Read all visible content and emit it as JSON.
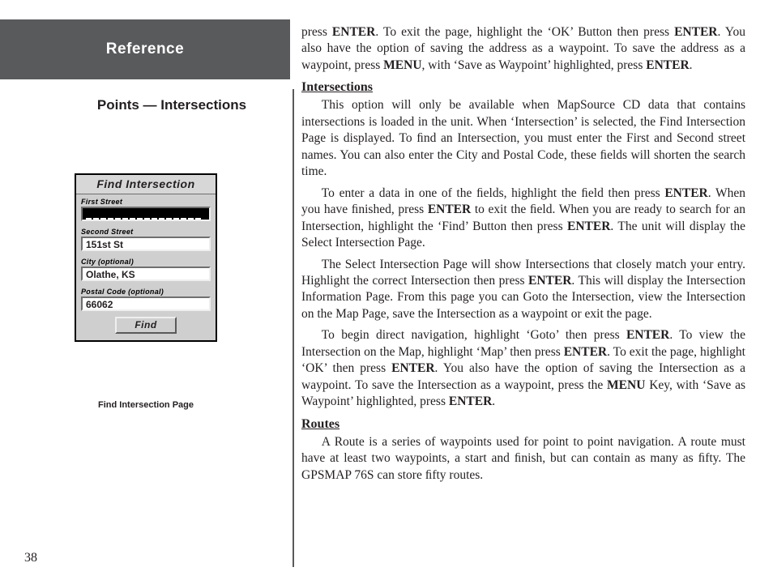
{
  "page_number": "38",
  "banner": {
    "title": "Reference"
  },
  "section_title": "Points — Intersections",
  "device": {
    "header": "Find Intersection",
    "labels": {
      "first_street": "First Street",
      "second_street": "Second Street",
      "city": "City (optional)",
      "postal": "Postal Code (optional)"
    },
    "values": {
      "first_street": "",
      "second_street": "151st St",
      "city": "Olathe, KS",
      "postal": "66062"
    },
    "find_btn": "Find",
    "caption": "Find Intersection Page"
  },
  "body": {
    "p1_a": "press ",
    "k_enter": "ENTER",
    "p1_b": ".  To exit the page, highlight the ‘OK’ Button then press ",
    "p1_c": ". You also have the option of saving the address as a waypoint.  To save the address as a waypoint, press ",
    "k_menu": "MENU",
    "p1_d": ", with ‘Save as Waypoint’ highlighted, press ",
    "p1_e": ".",
    "h_intersections": "Intersections",
    "p2": "This option will only be available when MapSource CD data that contains intersections is loaded in the unit.  When ‘Intersection’ is selected, the Find Intersection Page is displayed.  To ﬁnd an Intersection, you must enter the First and Second street names.  You can also enter the City and Postal Code, these ﬁelds will shorten the search time.",
    "p3_a": "To enter a data in one of the ﬁelds, highlight the ﬁeld then press ",
    "p3_b": ".  When you have ﬁnished, press ",
    "p3_c": " to exit the ﬁeld.  When you are ready to search for an Intersection, highlight the ‘Find’ Button then press ",
    "p3_d": ".  The unit will display the Select Intersection Page.",
    "p4_a": "The Select Intersection Page will show Intersections that closely match your entry.  Highlight the correct Intersection then press ",
    "p4_b": ".  This will display the Intersection Information Page.  From this page you can Goto the Intersection, view the Intersection on the Map Page, save the Intersection as a waypoint or exit the page.",
    "p5_a": "To begin direct navigation, highlight ‘Goto’ then press ",
    "p5_b": ".  To view the Intersection on the Map, highlight ‘Map’ then press ",
    "p5_c": ".  To exit the page, highlight ‘OK’ then press ",
    "p5_d": ". You also have the option of saving the Intersection as a waypoint.  To save the Intersection as a waypoint, press the ",
    "p5_e": " Key, with ‘Save as Waypoint’ highlighted, press ",
    "p5_f": ".",
    "h_routes": "Routes",
    "p6": "A Route is a series of waypoints used for point to point navigation.  A route must have at least two waypoints, a start and ﬁnish, but can contain as many as ﬁfty. The GPSMAP 76S can store ﬁfty routes."
  }
}
